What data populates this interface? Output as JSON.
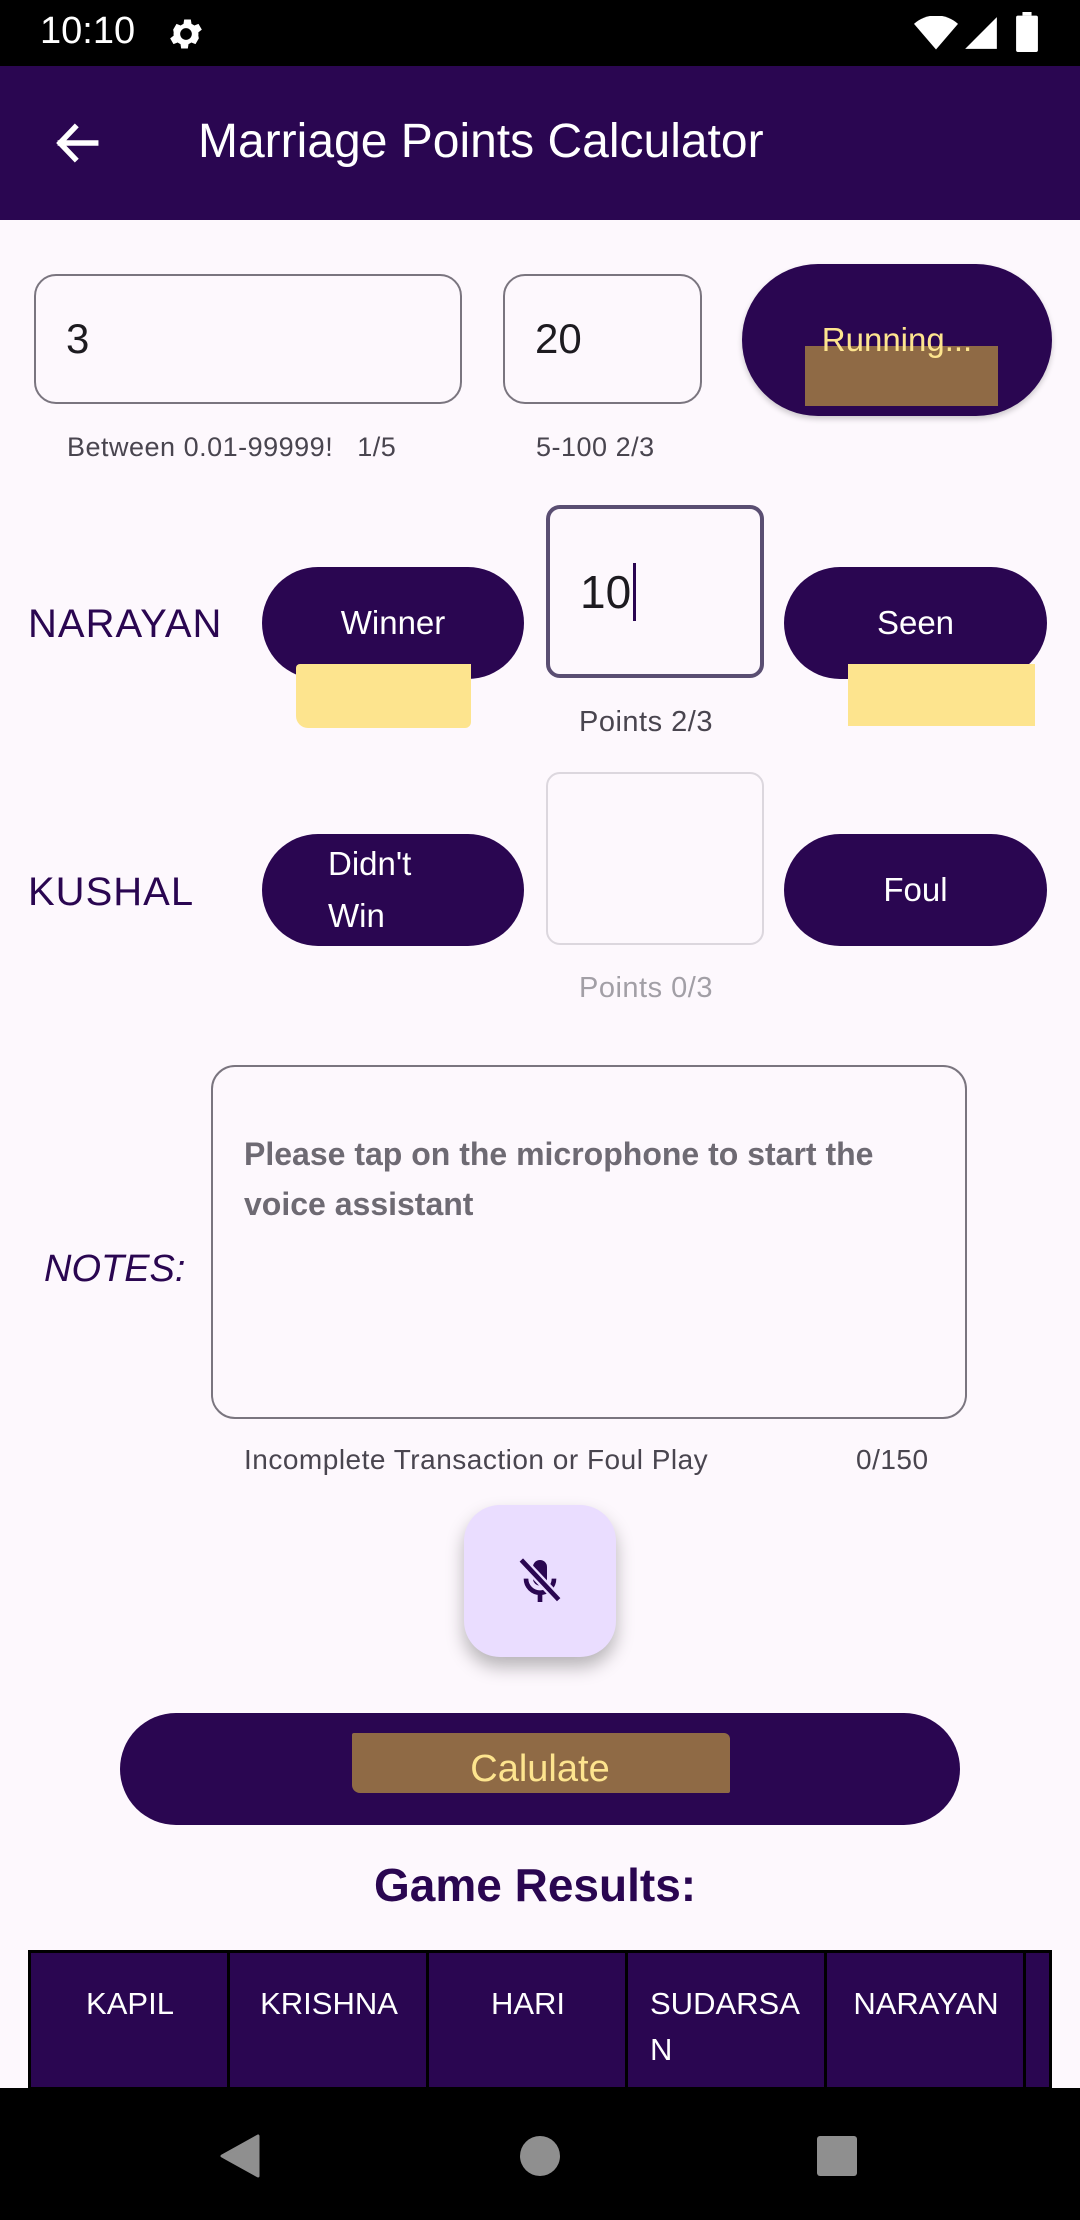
{
  "status_bar": {
    "time": "10:10"
  },
  "app_bar": {
    "title": "Marriage Points Calculator"
  },
  "settings": {
    "rate": {
      "value": "3",
      "helper": "Between 0.01-99999!",
      "counter": "1/5"
    },
    "points_limit": {
      "value": "20",
      "helper": "5-100",
      "counter": "2/3"
    },
    "running_button_label": "Running..."
  },
  "players": [
    {
      "name": "NARAYAN",
      "status_label": "Winner",
      "points": "10",
      "points_helper": "Points 2/3",
      "type_label": "Seen"
    },
    {
      "name": "KUSHAL",
      "status_label": "Didn't Win",
      "points": "",
      "points_helper": "Points 0/3",
      "type_label": "Foul"
    }
  ],
  "notes": {
    "label": "NOTES:",
    "placeholder": "Please tap on the microphone to start the voice assistant",
    "helper": "Incomplete Transaction or Foul Play",
    "counter": "0/150"
  },
  "calculate_button_label": "Calulate",
  "results": {
    "title": "Game Results:",
    "columns": [
      "KAPIL",
      "KRISHNA",
      "HARI",
      "SUDARSAN",
      "NARAYAN"
    ]
  },
  "colors": {
    "primary": "#2a0651",
    "highlight_yellow": "#fde48e",
    "highlight_brown": "#8f6a45",
    "fab_background": "#eaddff"
  },
  "icons": [
    "gear-icon",
    "wifi-icon",
    "signal-icon",
    "battery-icon",
    "back-arrow-icon",
    "mic-off-icon",
    "nav-back-icon",
    "nav-home-icon",
    "nav-recents-icon"
  ]
}
